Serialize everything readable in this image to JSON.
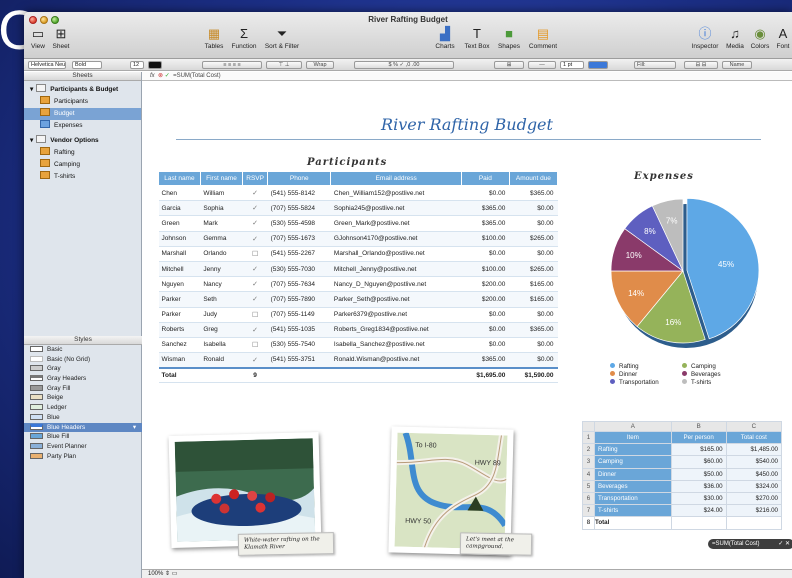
{
  "corner_letter": "C",
  "window": {
    "title": "River Rafting Budget"
  },
  "toolbar": {
    "left": [
      {
        "label": "View",
        "icon": "view-icon"
      },
      {
        "label": "Sheet",
        "icon": "sheet-icon"
      }
    ],
    "center_left": [
      {
        "label": "Tables",
        "icon": "tables-icon"
      },
      {
        "label": "Function",
        "icon": "function-icon"
      },
      {
        "label": "Sort & Filter",
        "icon": "sort-filter-icon"
      }
    ],
    "center_right": [
      {
        "label": "Charts",
        "icon": "charts-icon"
      },
      {
        "label": "Text Box",
        "icon": "textbox-icon"
      },
      {
        "label": "Shapes",
        "icon": "shapes-icon"
      },
      {
        "label": "Comment",
        "icon": "comment-icon"
      }
    ],
    "right": [
      {
        "label": "Inspector",
        "icon": "inspector-icon"
      },
      {
        "label": "Media",
        "icon": "media-icon"
      },
      {
        "label": "Colors",
        "icon": "colors-icon"
      },
      {
        "label": "Font",
        "icon": "font-icon"
      }
    ]
  },
  "format_bar": {
    "font": "Helvetica Neue",
    "weight": "Bold",
    "size": "12",
    "wrap": "Wrap",
    "stroke": "1 pt",
    "fill": "Fill:",
    "name": "Name"
  },
  "sidebar": {
    "sheets_header": "Sheets",
    "sheets": [
      {
        "label": "Participants & Budget",
        "type": "group"
      },
      {
        "label": "Participants",
        "type": "table"
      },
      {
        "label": "Budget",
        "type": "table"
      },
      {
        "label": "Expenses",
        "type": "chart"
      },
      {
        "label": "Vendor Options",
        "type": "group"
      },
      {
        "label": "Rafting",
        "type": "table"
      },
      {
        "label": "Camping",
        "type": "table"
      },
      {
        "label": "T-shirts",
        "type": "table"
      }
    ],
    "styles_header": "Styles",
    "styles": [
      "Basic",
      "Basic (No Grid)",
      "Gray",
      "Gray Headers",
      "Gray Fill",
      "Beige",
      "Ledger",
      "Blue",
      "Blue Headers",
      "Blue Fill",
      "Event Planner",
      "Party Plan"
    ],
    "selected_style": "Blue Headers"
  },
  "formula_bar": {
    "prefix": "fx",
    "formula": "=SUM(Total Cost)"
  },
  "doc": {
    "title": "River Rafting Budget"
  },
  "participants": {
    "title": "Participants",
    "columns": [
      "Last name",
      "First name",
      "RSVP",
      "Phone",
      "Email address",
      "Paid",
      "Amount due"
    ],
    "rows": [
      {
        "last": "Chen",
        "first": "William",
        "rsvp": true,
        "phone": "(541) 555-8142",
        "email": "Chen_William152@postlive.net",
        "paid": "$0.00",
        "due": "$365.00"
      },
      {
        "last": "Garcia",
        "first": "Sophia",
        "rsvp": true,
        "phone": "(707) 555-5824",
        "email": "Sophia245@postlive.net",
        "paid": "$365.00",
        "due": "$0.00"
      },
      {
        "last": "Green",
        "first": "Mark",
        "rsvp": true,
        "phone": "(530) 555-4598",
        "email": "Green_Mark@postlive.net",
        "paid": "$365.00",
        "due": "$0.00"
      },
      {
        "last": "Johnson",
        "first": "Gemma",
        "rsvp": true,
        "phone": "(707) 555-1673",
        "email": "GJohnson4170@postlive.net",
        "paid": "$100.00",
        "due": "$265.00"
      },
      {
        "last": "Marshall",
        "first": "Orlando",
        "rsvp": false,
        "phone": "(541) 555-2267",
        "email": "Marshall_Orlando@postlive.net",
        "paid": "$0.00",
        "due": "$0.00"
      },
      {
        "last": "Mitchell",
        "first": "Jenny",
        "rsvp": true,
        "phone": "(530) 555-7030",
        "email": "Mitchell_Jenny@postlive.net",
        "paid": "$100.00",
        "due": "$265.00"
      },
      {
        "last": "Nguyen",
        "first": "Nancy",
        "rsvp": true,
        "phone": "(707) 555-7634",
        "email": "Nancy_D_Nguyen@postlive.net",
        "paid": "$200.00",
        "due": "$165.00"
      },
      {
        "last": "Parker",
        "first": "Seth",
        "rsvp": true,
        "phone": "(707) 555-7890",
        "email": "Parker_Seth@postlive.net",
        "paid": "$200.00",
        "due": "$165.00"
      },
      {
        "last": "Parker",
        "first": "Judy",
        "rsvp": false,
        "phone": "(707) 555-1149",
        "email": "Parker6379@postlive.net",
        "paid": "$0.00",
        "due": "$0.00"
      },
      {
        "last": "Roberts",
        "first": "Greg",
        "rsvp": true,
        "phone": "(541) 555-1035",
        "email": "Roberts_Greg1834@postlive.net",
        "paid": "$0.00",
        "due": "$365.00"
      },
      {
        "last": "Sanchez",
        "first": "Isabella",
        "rsvp": false,
        "phone": "(530) 555-7540",
        "email": "Isabella_Sanchez@postlive.net",
        "paid": "$0.00",
        "due": "$0.00"
      },
      {
        "last": "Wisman",
        "first": "Ronald",
        "rsvp": true,
        "phone": "(541) 555-3751",
        "email": "Ronald.Wisman@postlive.net",
        "paid": "$365.00",
        "due": "$0.00"
      }
    ],
    "total": {
      "label": "Total",
      "rsvp": "9",
      "paid": "$1,695.00",
      "due": "$1,590.00"
    }
  },
  "chart_data": {
    "type": "pie",
    "title": "Expenses",
    "categories": [
      "Rafting",
      "Camping",
      "Dinner",
      "Beverages",
      "Transportation",
      "T-shirts"
    ],
    "values": [
      45,
      16,
      14,
      10,
      8,
      7
    ],
    "labels": [
      "45%",
      "16%",
      "14%",
      "10%",
      "8%",
      "7%"
    ],
    "colors": [
      "#5ea8e6",
      "#95b35a",
      "#e08c4a",
      "#8a3a6a",
      "#5e5fc0",
      "#bdbdbd"
    ],
    "legend_position": "bottom"
  },
  "photos": [
    {
      "caption": "White-water rafting on the Klamath River"
    },
    {
      "caption": "Let's meet at the campground.",
      "map_labels": [
        "To I-80",
        "HWY 89",
        "HWY 50"
      ]
    }
  ],
  "budget": {
    "col_letters": [
      "A",
      "B",
      "C"
    ],
    "columns": [
      "Item",
      "Per person",
      "Total cost"
    ],
    "rows": [
      {
        "n": "1",
        "item": "",
        "per": "",
        "total": ""
      },
      {
        "n": "2",
        "item": "Rafting",
        "per": "$165.00",
        "total": "$1,485.00"
      },
      {
        "n": "3",
        "item": "Camping",
        "per": "$60.00",
        "total": "$540.00"
      },
      {
        "n": "4",
        "item": "Dinner",
        "per": "$50.00",
        "total": "$450.00"
      },
      {
        "n": "5",
        "item": "Beverages",
        "per": "$36.00",
        "total": "$324.00"
      },
      {
        "n": "6",
        "item": "Transportation",
        "per": "$30.00",
        "total": "$270.00"
      },
      {
        "n": "7",
        "item": "T-shirts",
        "per": "$24.00",
        "total": "$216.00"
      }
    ],
    "total_row": {
      "n": "8",
      "item": "Total"
    },
    "formula": "=SUM(Total Cost)"
  },
  "status": {
    "zoom": "100%"
  }
}
